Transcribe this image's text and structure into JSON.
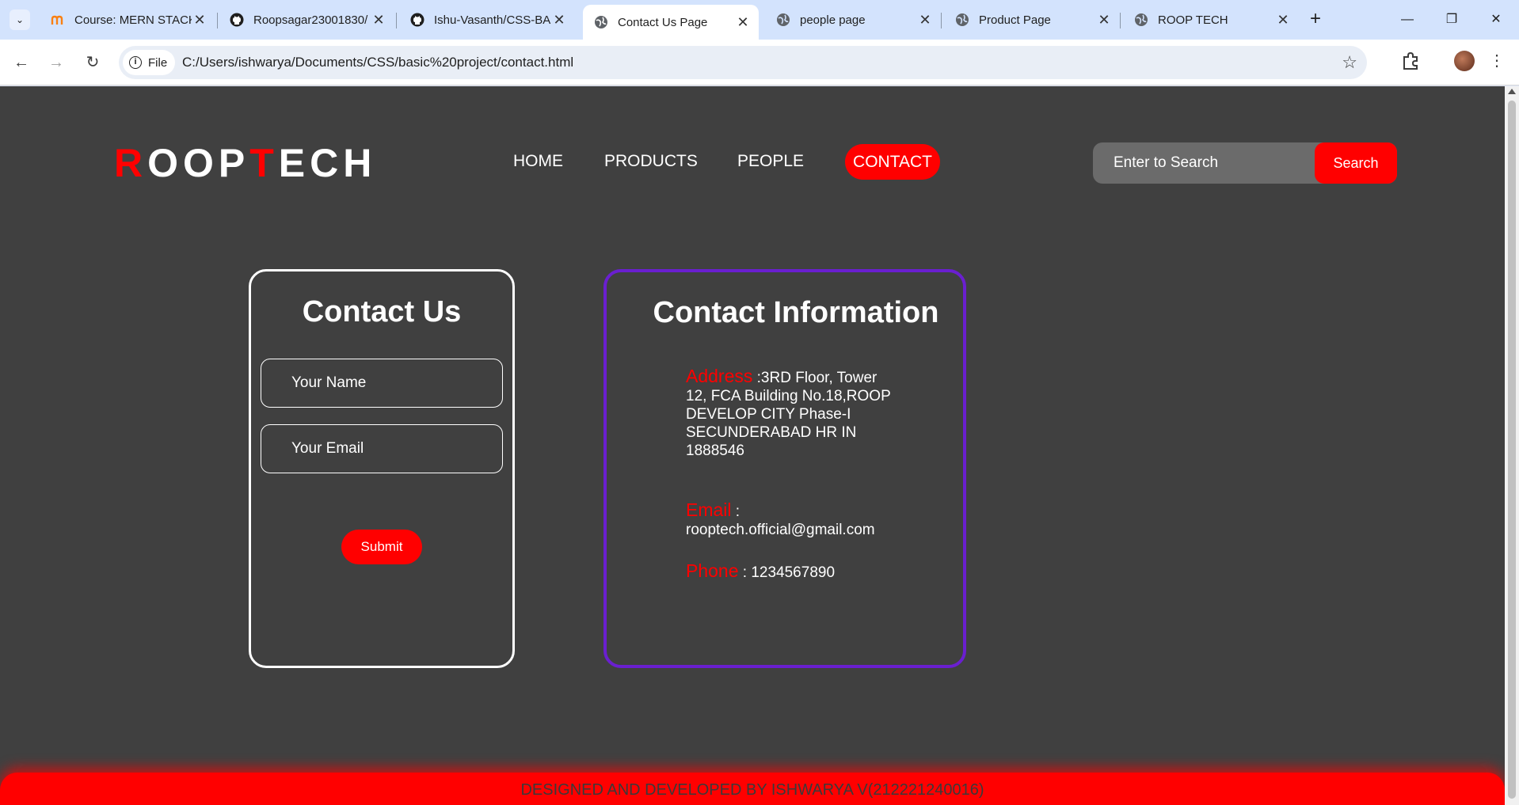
{
  "browser": {
    "tabs": [
      {
        "title": "Course: MERN STACK",
        "favicon": "moodle-icon"
      },
      {
        "title": "Roopsagar23001830/",
        "favicon": "github-icon"
      },
      {
        "title": "Ishu-Vasanth/CSS-BA",
        "favicon": "github-icon"
      },
      {
        "title": "Contact Us Page",
        "favicon": "globe-icon",
        "active": true
      },
      {
        "title": "people page",
        "favicon": "globe-icon"
      },
      {
        "title": "Product Page",
        "favicon": "globe-icon"
      },
      {
        "title": "ROOP TECH",
        "favicon": "globe-icon"
      }
    ],
    "chip_label": "File",
    "url": "C:/Users/ishwarya/Documents/CSS/basic%20project/contact.html"
  },
  "site": {
    "logo": {
      "r1": "R",
      "p1": "OOP",
      "r2": "T",
      "p2": "ECH"
    },
    "nav": {
      "home": "HOME",
      "products": "PRODUCTS",
      "people": "PEOPLE",
      "contact": "CONTACT"
    },
    "search": {
      "placeholder": "Enter to Search",
      "button": "Search"
    },
    "contact_form": {
      "title": "Contact Us",
      "name_placeholder": "Your Name",
      "email_placeholder": "Your Email",
      "submit": "Submit"
    },
    "contact_info": {
      "title": "Contact Information",
      "address_label": "Address",
      "address_value": " :3RD Floor, Tower 12, FCA Building No.18,ROOP DEVELOP CITY Phase-I SECUNDERABAD HR IN 1888546",
      "email_label": "Email",
      "email_value": " : rooptech.official@gmail.com",
      "phone_label": "Phone",
      "phone_value": " : 1234567890"
    },
    "footer": "DESIGNED AND DEVELOPED BY ISHWARYA V(212221240016)"
  },
  "colors": {
    "accent": "#ff0000",
    "page_bg": "#404040",
    "info_border": "#6a1fd0"
  }
}
